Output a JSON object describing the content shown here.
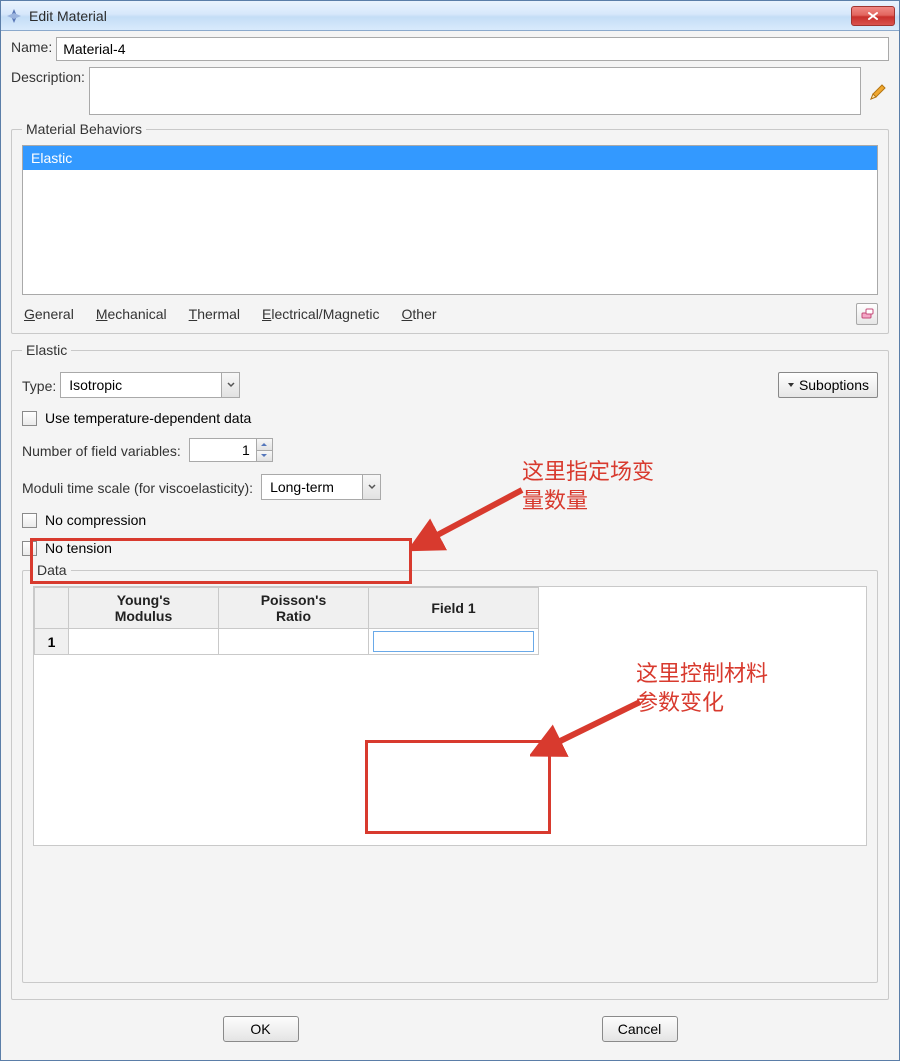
{
  "titlebar": {
    "title": "Edit Material"
  },
  "name_label": "Name:",
  "name_value": "Material-4",
  "description_label": "Description:",
  "description_value": "",
  "behaviors": {
    "legend": "Material Behaviors",
    "items": [
      "Elastic"
    ],
    "menus": {
      "general": "General",
      "mechanical": "Mechanical",
      "thermal": "Thermal",
      "electrical": "Electrical/Magnetic",
      "other": "Other"
    }
  },
  "elastic": {
    "legend": "Elastic",
    "type_label": "Type:",
    "type_value": "Isotropic",
    "suboptions_label": "Suboptions",
    "use_temp_label": "Use temperature-dependent data",
    "nfield_label": "Number of field variables:",
    "nfield_value": "1",
    "moduli_label": "Moduli time scale (for viscoelasticity):",
    "moduli_value": "Long-term",
    "no_compression_label": "No compression",
    "no_tension_label": "No tension"
  },
  "data": {
    "legend": "Data",
    "headers": [
      "Young's\nModulus",
      "Poisson's\nRatio",
      "Field 1"
    ],
    "rows": [
      {
        "n": "1",
        "cells": [
          "",
          "",
          ""
        ]
      }
    ]
  },
  "buttons": {
    "ok": "OK",
    "cancel": "Cancel"
  },
  "annotations": {
    "a1": "这里指定场变\n量数量",
    "a2": "这里控制材料\n参数变化"
  }
}
